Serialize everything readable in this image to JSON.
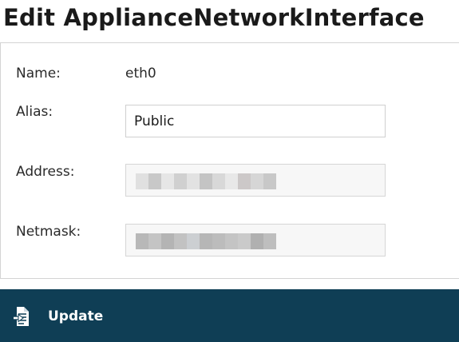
{
  "page": {
    "title": "Edit ApplianceNetworkInterface"
  },
  "form": {
    "name": {
      "label": "Name:",
      "value": "eth0"
    },
    "alias": {
      "label": "Alias:",
      "value": "Public"
    },
    "address": {
      "label": "Address:",
      "value_state": "redacted (pixelated)"
    },
    "netmask": {
      "label": "Netmask:",
      "value_state": "redacted (pixelated)"
    }
  },
  "actions": {
    "update_label": "Update",
    "update_icon": "document-import-icon"
  },
  "colors": {
    "action_bar": "#0f3e55",
    "panel_border": "#d4d4d4"
  }
}
